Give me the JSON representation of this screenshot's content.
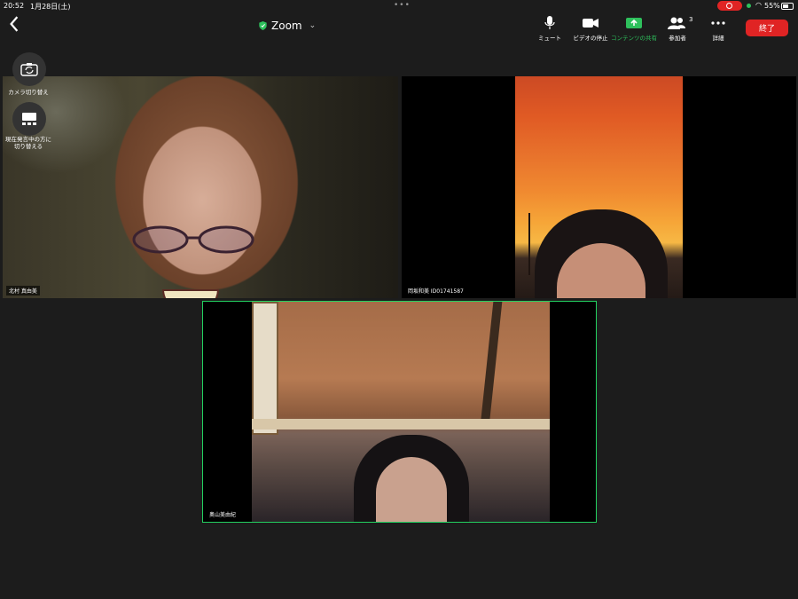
{
  "status_bar": {
    "time": "20:52",
    "date": "1月28日(土)",
    "battery": "55%"
  },
  "header": {
    "app_title": "Zoom"
  },
  "toolbar": {
    "mute_label": "ミュート",
    "video_label": "ビデオの停止",
    "share_label": "コンテンツの共有",
    "participants_label": "参加者",
    "participants_count": "3",
    "more_label": "詳細",
    "end_label": "終了"
  },
  "side_controls": {
    "switch_camera_label": "カメラ切り替え",
    "switch_view_label": "現在発言中の方に切り替える"
  },
  "participants": [
    {
      "name": "北村 真由美"
    },
    {
      "name": "岡坂和美 ID01741587"
    },
    {
      "name": "奥山美由紀"
    }
  ],
  "colors": {
    "accent_green": "#23d160",
    "end_red": "#e02424",
    "background": "#1c1c1c"
  }
}
